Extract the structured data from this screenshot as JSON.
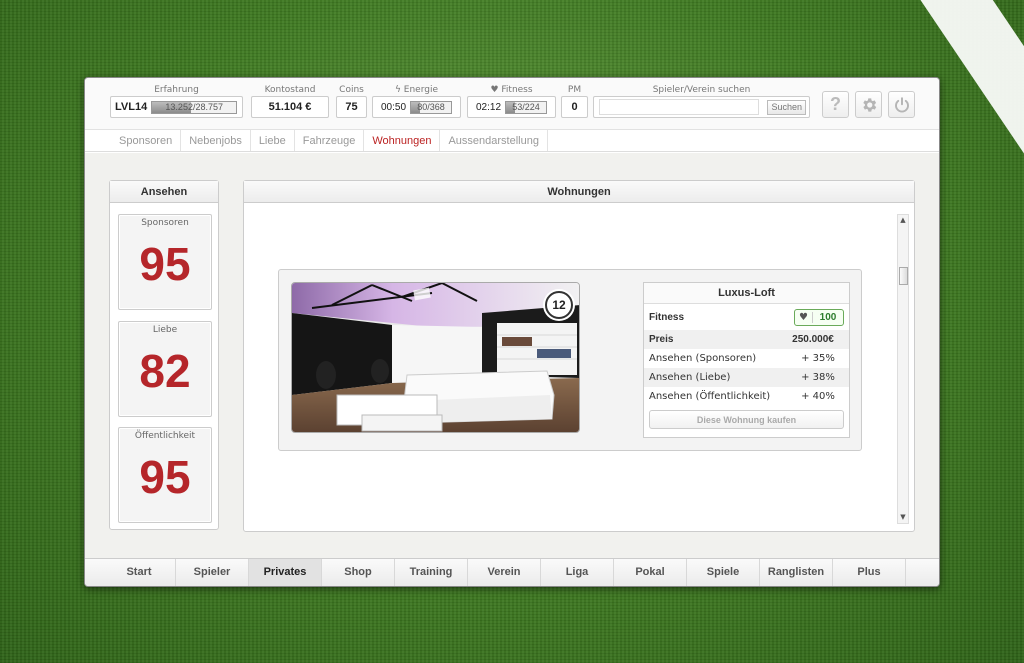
{
  "stats": {
    "erfahrung_label": "Erfahrung",
    "level": "LVL14",
    "xp_text": "13.252/28.757",
    "xp_fill": 0.461,
    "kontostand_label": "Kontostand",
    "kontostand": "51.104 €",
    "coins_label": "Coins",
    "coins": "75",
    "energie_label": "Energie",
    "energie_time": "00:50",
    "energie_text": "80/368",
    "energie_fill": 0.217,
    "fitness_label": "Fitness",
    "fitness_time": "02:12",
    "fitness_text": "53/224",
    "fitness_fill": 0.237,
    "pm_label": "PM",
    "pm": "0",
    "search_label": "Spieler/Verein suchen",
    "search_placeholder": "",
    "search_button": "Suchen"
  },
  "subnav": {
    "items": [
      "Sponsoren",
      "Nebenjobs",
      "Liebe",
      "Fahrzeuge",
      "Wohnungen",
      "Aussendarstellung"
    ],
    "active": "Wohnungen"
  },
  "ansehen": {
    "title": "Ansehen",
    "sponsoren_label": "Sponsoren",
    "sponsoren": "95",
    "liebe_label": "Liebe",
    "liebe": "82",
    "oeff_label": "Öffentlichkeit",
    "oeff": "95"
  },
  "wohnungen": {
    "title": "Wohnungen",
    "offer": {
      "badge": "12",
      "name": "Luxus-Loft",
      "fitness_label": "Fitness",
      "fitness_value": "100",
      "preis_label": "Preis",
      "preis_value": "250.000€",
      "rows": [
        {
          "label": "Ansehen (Sponsoren)",
          "value": "+ 35%"
        },
        {
          "label": "Ansehen (Liebe)",
          "value": "+ 38%"
        },
        {
          "label": "Ansehen (Öffentlichkeit)",
          "value": "+ 40%"
        }
      ],
      "buy_button": "Diese Wohnung kaufen"
    }
  },
  "bottomnav": {
    "items": [
      "Start",
      "Spieler",
      "Privates",
      "Shop",
      "Training",
      "Verein",
      "Liga",
      "Pokal",
      "Spiele",
      "Ranglisten",
      "Plus"
    ],
    "active": "Privates"
  },
  "icons": [
    "help-icon",
    "gear-icon",
    "power-icon",
    "bolt-icon",
    "heart-icon"
  ]
}
